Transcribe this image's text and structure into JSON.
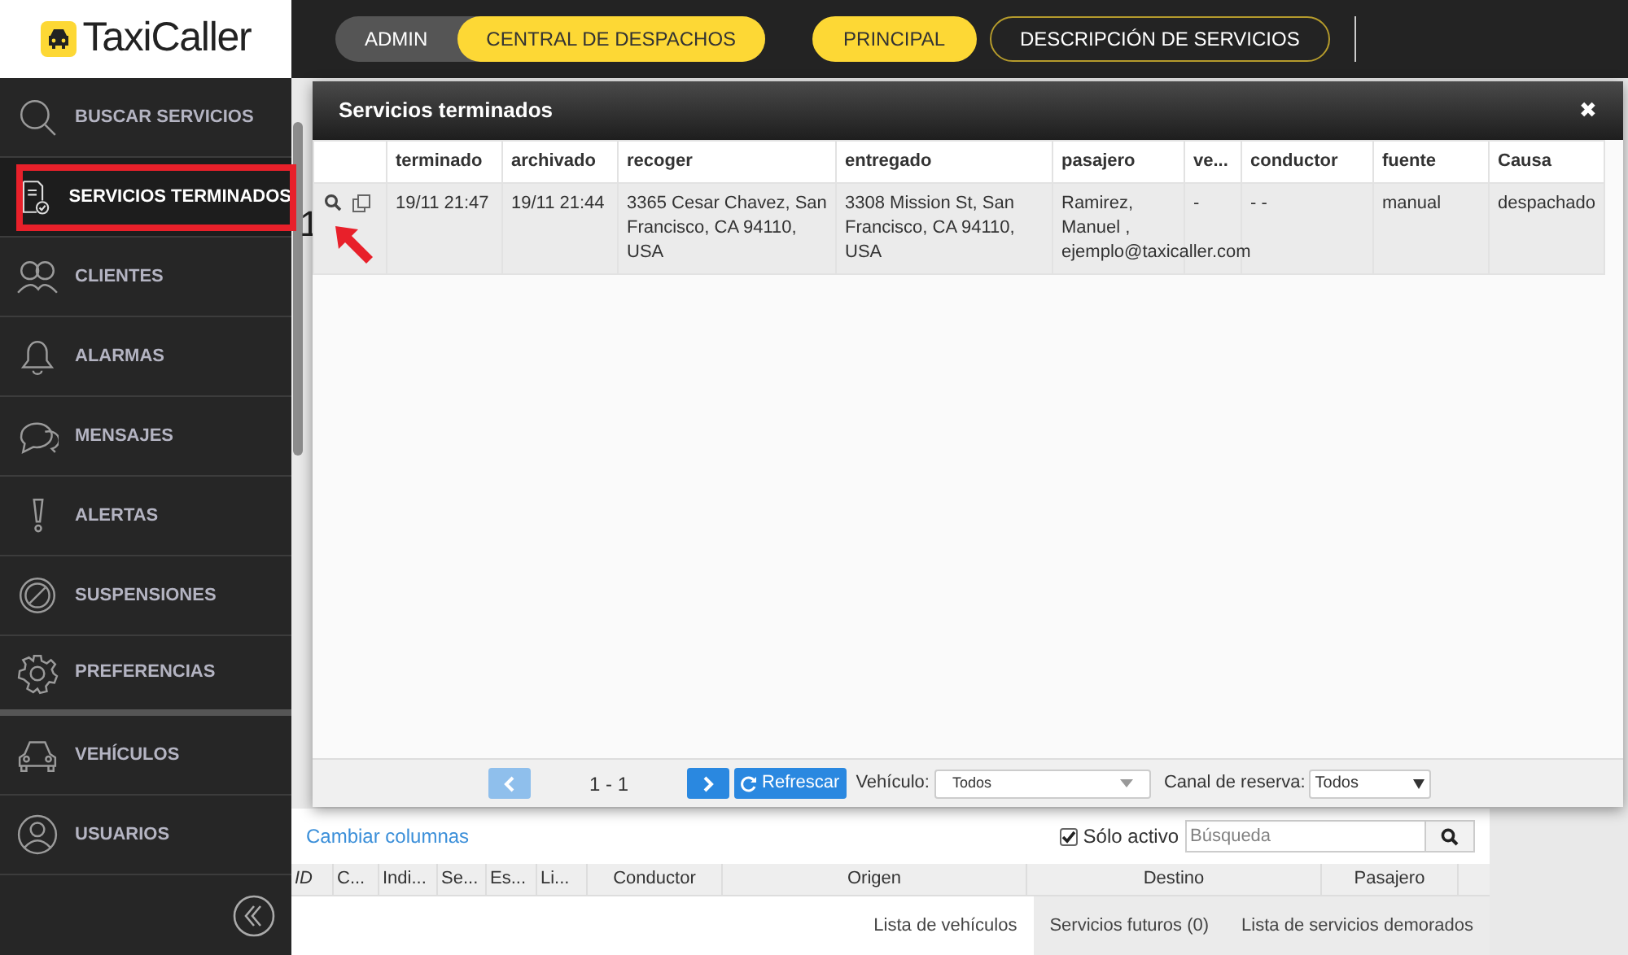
{
  "logo": {
    "text": "TaxiCaller"
  },
  "top_nav": {
    "segments": [
      {
        "label": "ADMIN",
        "selected": false
      },
      {
        "label": "CENTRAL DE DESPACHOS",
        "selected": true
      }
    ],
    "buttons": [
      {
        "label": "PRINCIPAL",
        "kind": "filled"
      },
      {
        "label": "DESCRIPCIÓN DE SERVICIOS",
        "kind": "outline"
      }
    ]
  },
  "sidebar": {
    "items": [
      {
        "label": "BUSCAR SERVICIOS",
        "selected": false
      },
      {
        "label": "SERVICIOS TERMINADOS",
        "selected": true
      },
      {
        "label": "CLIENTES",
        "selected": false
      },
      {
        "label": "ALARMAS",
        "selected": false
      },
      {
        "label": "MENSAJES",
        "selected": false
      },
      {
        "label": "ALERTAS",
        "selected": false
      },
      {
        "label": "SUSPENSIONES",
        "selected": false
      },
      {
        "label": "PREFERENCIAS",
        "selected": false
      },
      {
        "label": "VEHÍCULOS",
        "selected": false
      },
      {
        "label": "USUARIOS",
        "selected": false
      }
    ]
  },
  "background": {
    "digit": "1",
    "change_columns": "Cambiar columnas",
    "only_active": {
      "label": "Sólo activo",
      "checked": true
    },
    "search": {
      "placeholder": "Búsqueda"
    },
    "columns": [
      "ID",
      "C...",
      "Indi...",
      "Se...",
      "Es...",
      "Li...",
      "Conductor",
      "Origen",
      "Destino",
      "Pasajero"
    ],
    "tabs": [
      {
        "label": "Lista de vehículos",
        "selected": true
      },
      {
        "label": "Servicios futuros (0)",
        "selected": false
      },
      {
        "label": "Lista de servicios demorados",
        "selected": false
      }
    ]
  },
  "modal": {
    "title": "Servicios terminados",
    "close": "✖",
    "columns": [
      "terminado",
      "archivado",
      "recoger",
      "entregado",
      "pasajero",
      "ve...",
      "conductor",
      "fuente",
      "Causa"
    ],
    "rows": [
      {
        "cells": [
          "19/11 21:47",
          "19/11 21:44",
          "3365 Cesar Chavez, San Francisco, CA 94110, USA",
          "3308 Mission St, San Francisco, CA 94110, USA",
          [
            "Ramirez,",
            "Manuel ,",
            "ejemplo@taxicaller.com"
          ],
          "-",
          "- -",
          "manual",
          "despachado"
        ]
      }
    ],
    "pager": {
      "prev_disabled": true,
      "next_disabled": false,
      "range": "1 - 1",
      "refresh": "Refrescar",
      "vehicle_label": "Vehículo:",
      "vehicle_value": "Todos",
      "channel_label": "Canal de reserva:",
      "channel_value": "Todos"
    }
  }
}
